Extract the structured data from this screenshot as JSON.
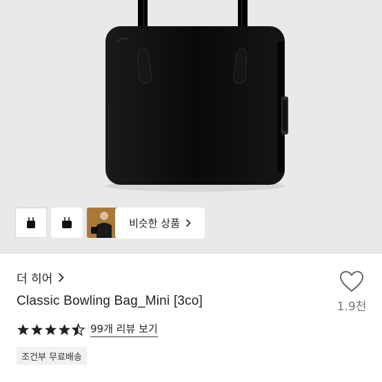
{
  "product_gallery": {
    "similar_button": {
      "label": "비슷한 상품",
      "icon": "chevron-right-icon"
    },
    "thumbnails": [
      {
        "name": "bag-front",
        "selected": true
      },
      {
        "name": "bag-angle",
        "selected": false
      },
      {
        "name": "model-photo",
        "selected": false
      }
    ]
  },
  "product": {
    "shop_name": "더 히어",
    "title": "Classic Bowling Bag_Mini [3co]",
    "rating": 4.5,
    "review_link": "99개 리뷰 보기",
    "shipping_badge": "조건부 무료배송",
    "like_count": "1.9천"
  },
  "colors": {
    "hero_bg": "#e9e9eb",
    "bag": "#0d0d0d",
    "text": "#222222",
    "muted": "#777777",
    "badge_bg": "#f1f1f3"
  }
}
